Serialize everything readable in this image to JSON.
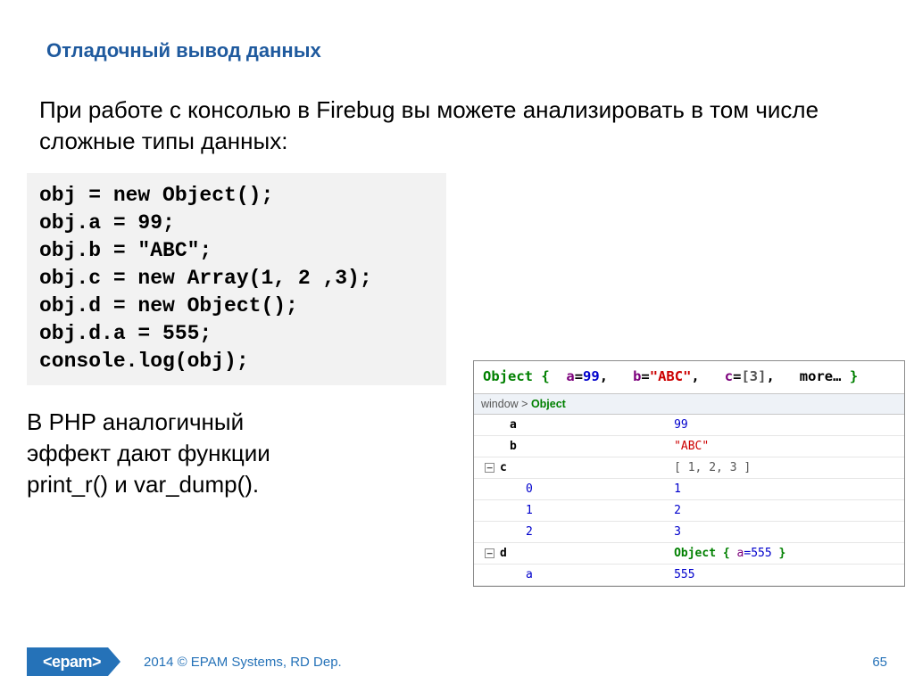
{
  "title": "Отладочный вывод данных",
  "intro": "При работе с консолью в Firebug вы можете анализировать в том числе сложные типы данных:",
  "code": "obj = new Object();\nobj.a = 99;\nobj.b = \"ABC\";\nobj.c = new Array(1, 2 ,3);\nobj.d = new Object();\nobj.d.a = 555;\nconsole.log(obj);",
  "php_note": "В PHP аналогичный эффект дают функции print_r() и var_dump().",
  "firebug": {
    "console": {
      "label": "Object",
      "lb": "{",
      "rb": "}",
      "a_key": "a",
      "eq": "=",
      "a_val": "99",
      "b_key": "b",
      "b_val": "\"ABC\"",
      "c_key": "c",
      "c_val": "[3]",
      "more": "more…",
      "comma": ","
    },
    "breadcrumb": {
      "win": "window",
      "sep": " > ",
      "obj": "Object"
    },
    "rows": [
      {
        "toggle": "",
        "indent": 0,
        "key": "a",
        "val": "99",
        "cls": ""
      },
      {
        "toggle": "",
        "indent": 0,
        "key": "b",
        "val": "\"ABC\"",
        "cls": "val-str"
      },
      {
        "toggle": "−",
        "indent": 0,
        "key": "c",
        "val": "[ 1, 2, 3 ]",
        "cls": "val-arr"
      },
      {
        "toggle": "",
        "indent": 1,
        "key": "0",
        "val": "1",
        "cls": ""
      },
      {
        "toggle": "",
        "indent": 1,
        "key": "1",
        "val": "2",
        "cls": ""
      },
      {
        "toggle": "",
        "indent": 1,
        "key": "2",
        "val": "3",
        "cls": ""
      },
      {
        "toggle": "−",
        "indent": 0,
        "key": "d",
        "val": "__OBJ__",
        "cls": ""
      },
      {
        "toggle": "",
        "indent": 1,
        "key": "a",
        "val": "555",
        "cls": ""
      }
    ],
    "nested_obj": {
      "label": "Object",
      "lb": "{",
      "rb": "}",
      "key": "a",
      "eq": "=",
      "val": "555"
    }
  },
  "footer": {
    "logo": "<epam>",
    "copyright": "2014 © EPAM Systems, RD Dep.",
    "page": "65"
  }
}
